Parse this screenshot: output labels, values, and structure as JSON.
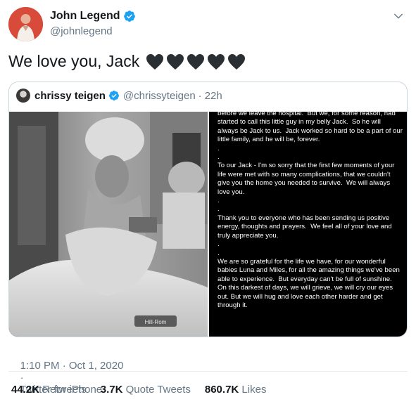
{
  "author": {
    "display_name": "John Legend",
    "handle": "@johnlegend",
    "verified_icon": "verified-badge-icon",
    "avatar_color": "#d84a3a"
  },
  "tweet_text": "We love you, Jack",
  "hearts": [
    "black-heart-icon",
    "black-heart-icon",
    "black-heart-icon",
    "black-heart-icon",
    "black-heart-icon"
  ],
  "quoted": {
    "display_name": "chrissy teigen",
    "handle": "@chrissyteigen",
    "separator": "·",
    "time": "22h",
    "photo_label": "Hill-Rom",
    "note_paragraphs": [
      "before we leave the hospital.  But we, for some reason, had started to call this little guy in my belly Jack.  So he will always be Jack to us.  Jack worked so hard to be a part of our little family, and he will be, forever.",
      ".",
      ".",
      "To our Jack - I'm so sorry that the first few moments of your life were met with so many complications, that we couldn't give you the home you needed to survive.  We will always love you.",
      ".",
      ".",
      "Thank you to everyone who has been sending us positive energy, thoughts and prayers.  We feel all of your love and truly appreciate you.",
      ".",
      ".",
      "We are so grateful for the life we have, for our wonderful babies Luna and Miles, for all the amazing things we've been able to experience.  But everyday can't be full of sunshine.  On this darkest of days, we will grieve, we will cry our eyes out. But we will hug and love each other harder and get through it."
    ]
  },
  "meta": {
    "timestamp": "1:10 PM · Oct 1, 2020",
    "separator": "·",
    "source": "Twitter for iPhone"
  },
  "stats": {
    "retweets_count": "44.2K",
    "retweets_label": "Retweets",
    "quotes_count": "3.7K",
    "quotes_label": "Quote Tweets",
    "likes_count": "860.7K",
    "likes_label": "Likes"
  },
  "colors": {
    "link_blue": "#1da1f2",
    "secondary_text": "#657786",
    "border": "#e6ecf0"
  }
}
